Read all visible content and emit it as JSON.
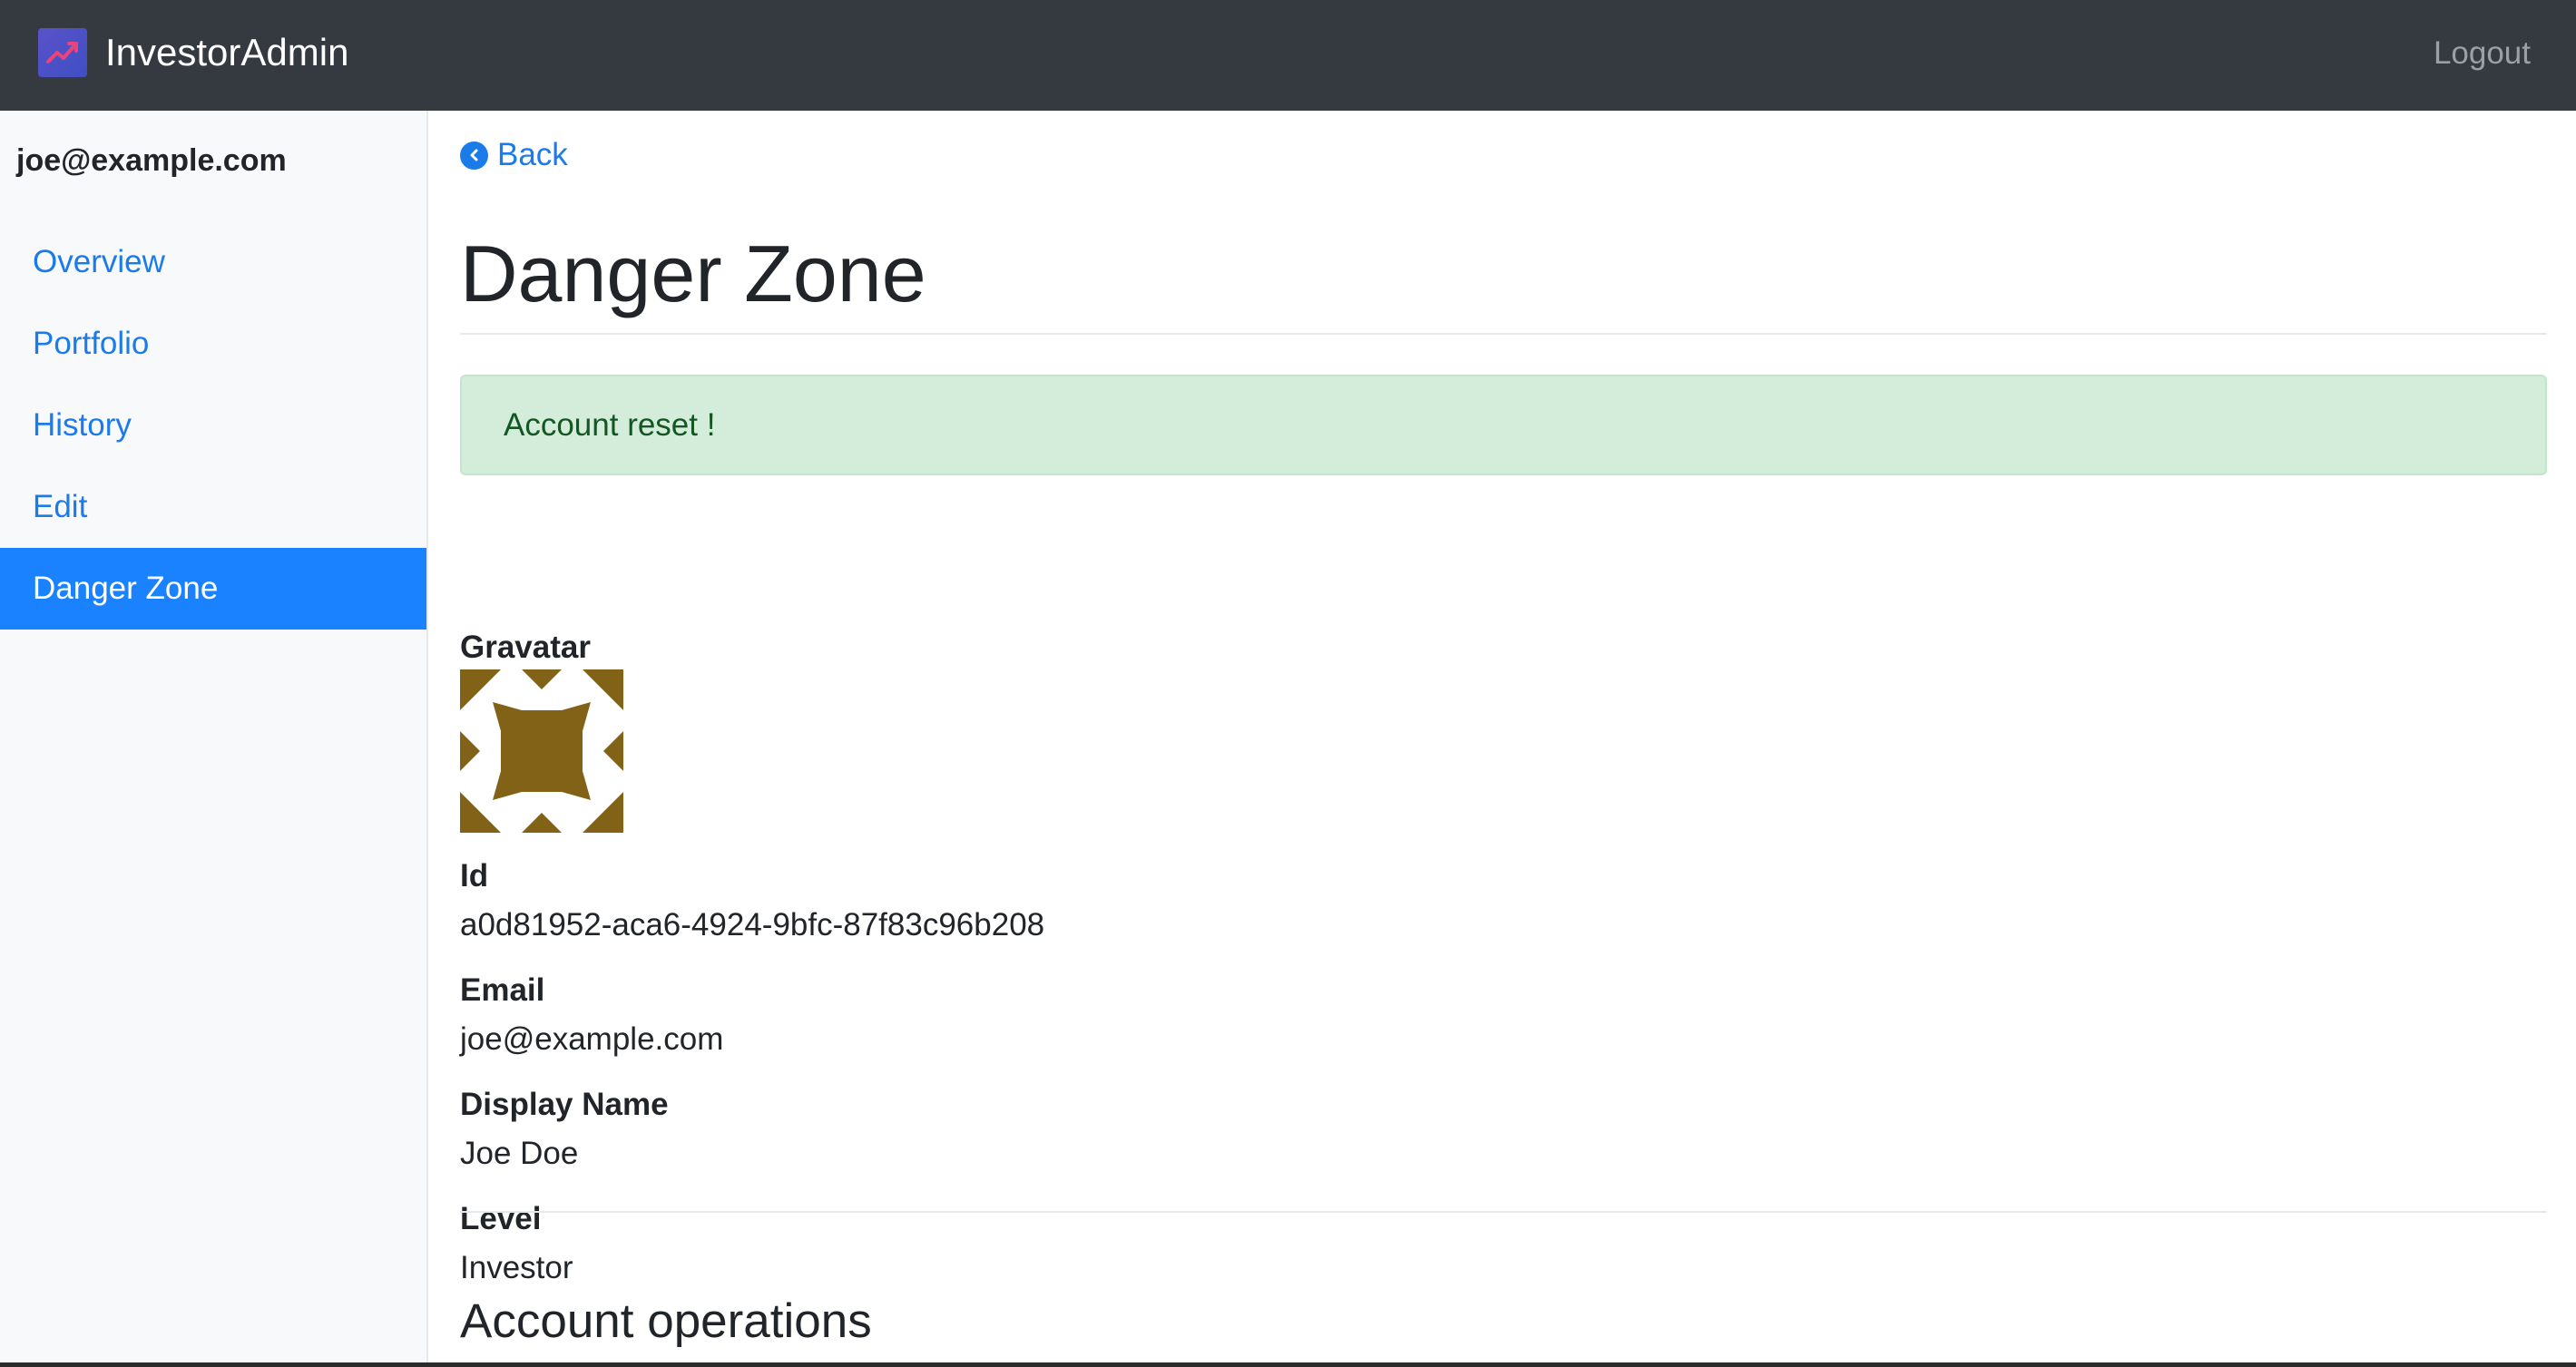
{
  "navbar": {
    "brand": "InvestorAdmin",
    "logo_icon": "trend-chart-icon",
    "logout_label": "Logout"
  },
  "sidebar": {
    "user_email": "joe@example.com",
    "items": [
      {
        "label": "Overview"
      },
      {
        "label": "Portfolio"
      },
      {
        "label": "History"
      },
      {
        "label": "Edit"
      },
      {
        "label": "Danger Zone",
        "active": true
      }
    ]
  },
  "main": {
    "back_label": "Back",
    "title": "Danger Zone",
    "alert": "Account reset !",
    "gravatar_label": "Gravatar",
    "fields": {
      "id_label": "Id",
      "id_value": "a0d81952-aca6-4924-9bfc-87f83c96b208",
      "email_label": "Email",
      "email_value": "joe@example.com",
      "display_name_label": "Display Name",
      "display_name_value": "Joe Doe",
      "level_label": "Level",
      "level_value": "Investor"
    },
    "section_title": "Account operations"
  },
  "colors": {
    "navbar_bg": "#343a40",
    "link": "#1a7be9",
    "active_bg": "#1a82ff",
    "alert_bg": "#d4edda",
    "alert_text": "#155724",
    "gravatar": "#826217"
  }
}
